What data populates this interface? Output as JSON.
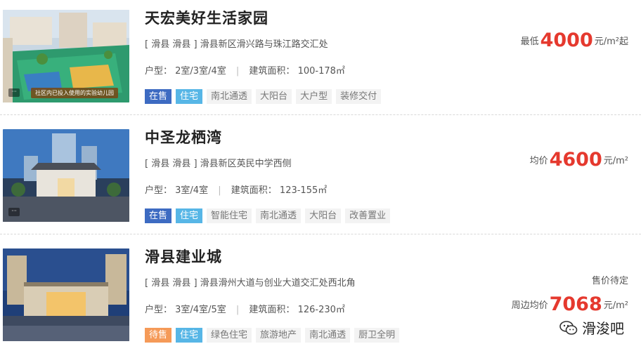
{
  "listings": [
    {
      "title": "天宏美好生活家园",
      "address": "[ 滑县 滑县 ] 滑县新区滑兴路与珠江路交汇处",
      "rooms_label": "户型：",
      "rooms": "2室/3室/4室",
      "area_label": "建筑面积：",
      "area": "100-178㎡",
      "status": "在售",
      "type": "住宅",
      "tags": [
        "南北通透",
        "大阳台",
        "大户型",
        "装修交付"
      ],
      "price_prefix": "最低",
      "price": "4000",
      "price_unit": "元/m²起",
      "image_caption": "社区内已投入使用的实验幼儿园"
    },
    {
      "title": "中圣龙栖湾",
      "address": "[ 滑县 滑县 ] 滑县新区英民中学西侧",
      "rooms_label": "户型：",
      "rooms": "3室/4室",
      "area_label": "建筑面积：",
      "area": "123-155㎡",
      "status": "在售",
      "type": "住宅",
      "tags": [
        "智能住宅",
        "南北通透",
        "大阳台",
        "改善置业"
      ],
      "price_prefix": "均价",
      "price": "4600",
      "price_unit": "元/m²"
    },
    {
      "title": "滑县建业城",
      "address": "[ 滑县 滑县 ] 滑县滑州大道与创业大道交汇处西北角",
      "rooms_label": "户型：",
      "rooms": "3室/4室/5室",
      "area_label": "建筑面积：",
      "area": "126-230㎡",
      "status": "待售",
      "type": "住宅",
      "tags": [
        "绿色住宅",
        "旅游地产",
        "南北通透",
        "厨卫全明"
      ],
      "price_note": "售价待定",
      "price_prefix": "周边均价",
      "price": "7068",
      "price_unit": "元/m²"
    }
  ],
  "watermark": "滑浚吧",
  "colors": {
    "status_on_sale": "#3d6bc2",
    "status_pending": "#f59a58",
    "type_tag": "#57b6e6",
    "price": "#e5392e"
  }
}
